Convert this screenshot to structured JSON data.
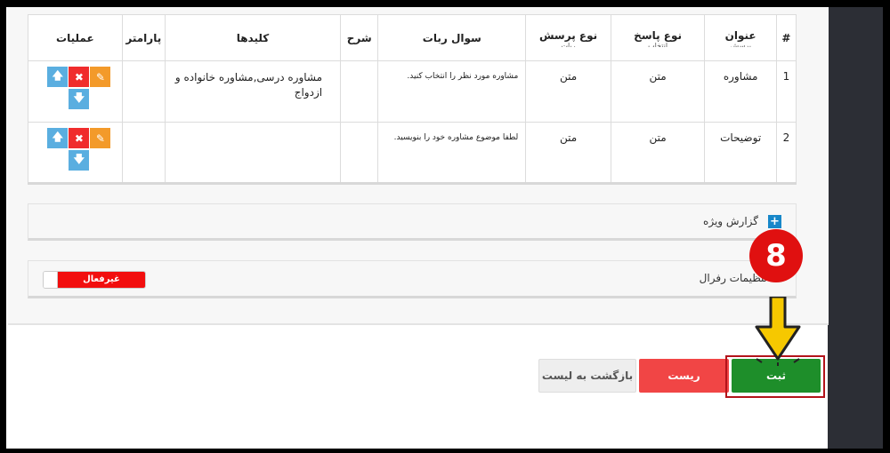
{
  "table": {
    "headers": {
      "row_num": "#",
      "title": "عنوان",
      "title_sub": "پرسش",
      "answer_type": "نوع پاسخ",
      "answer_sub": "انتخاب",
      "question_type": "نوع پرسش",
      "question_sub": "ربات",
      "bot_question": "سوال ربات",
      "description": "شرح",
      "keywords": "کلیدها",
      "parameter": "پارامتر",
      "operations": "عملیات"
    },
    "rows": [
      {
        "num": "1",
        "title": "مشاوره",
        "answer_type": "متن",
        "question_type": "متن",
        "bot_question": "مشاوره مورد نظر را انتخاب کنید.",
        "description": "",
        "keywords": "مشاوره درسی,مشاوره خانواده و ازدواج",
        "parameter": ""
      },
      {
        "num": "2",
        "title": "توضیحات",
        "answer_type": "متن",
        "question_type": "متن",
        "bot_question": "لطفا موضوع مشاوره خود را بنویسید.",
        "description": "",
        "keywords": "",
        "parameter": ""
      }
    ],
    "op_icons": [
      "pencil-icon",
      "times-icon",
      "arrow-up-icon",
      "arrow-down-icon"
    ]
  },
  "report": {
    "label": "گزارش ویژه",
    "icon": "plus-square-icon"
  },
  "referral": {
    "label": "تنظیمات رفرال",
    "toggle_text": "غیرفعال",
    "toggle_state": "off"
  },
  "buttons": {
    "back": "بازگشت به لیست",
    "reset": "ریست",
    "submit": "ثبت"
  },
  "annotation": {
    "step": "8"
  },
  "colors": {
    "submit": "#1e8e2a",
    "reset": "#f14545",
    "badge": "#e01010",
    "arrow": "#f6c800",
    "toggle": "#f20e0e"
  }
}
